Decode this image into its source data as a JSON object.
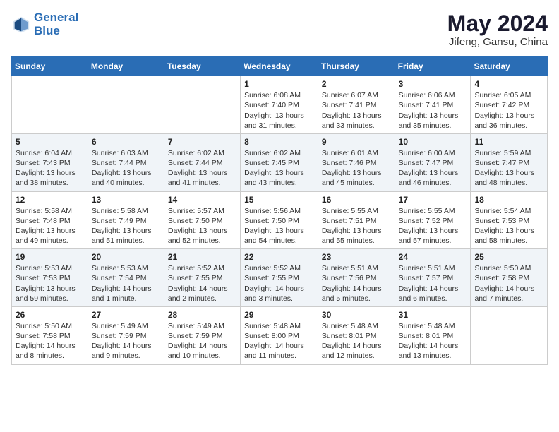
{
  "header": {
    "logo_line1": "General",
    "logo_line2": "Blue",
    "month_title": "May 2024",
    "subtitle": "Jifeng, Gansu, China"
  },
  "days_of_week": [
    "Sunday",
    "Monday",
    "Tuesday",
    "Wednesday",
    "Thursday",
    "Friday",
    "Saturday"
  ],
  "weeks": [
    [
      {
        "day": "",
        "info": ""
      },
      {
        "day": "",
        "info": ""
      },
      {
        "day": "",
        "info": ""
      },
      {
        "day": "1",
        "info": "Sunrise: 6:08 AM\nSunset: 7:40 PM\nDaylight: 13 hours\nand 31 minutes."
      },
      {
        "day": "2",
        "info": "Sunrise: 6:07 AM\nSunset: 7:41 PM\nDaylight: 13 hours\nand 33 minutes."
      },
      {
        "day": "3",
        "info": "Sunrise: 6:06 AM\nSunset: 7:41 PM\nDaylight: 13 hours\nand 35 minutes."
      },
      {
        "day": "4",
        "info": "Sunrise: 6:05 AM\nSunset: 7:42 PM\nDaylight: 13 hours\nand 36 minutes."
      }
    ],
    [
      {
        "day": "5",
        "info": "Sunrise: 6:04 AM\nSunset: 7:43 PM\nDaylight: 13 hours\nand 38 minutes."
      },
      {
        "day": "6",
        "info": "Sunrise: 6:03 AM\nSunset: 7:44 PM\nDaylight: 13 hours\nand 40 minutes."
      },
      {
        "day": "7",
        "info": "Sunrise: 6:02 AM\nSunset: 7:44 PM\nDaylight: 13 hours\nand 41 minutes."
      },
      {
        "day": "8",
        "info": "Sunrise: 6:02 AM\nSunset: 7:45 PM\nDaylight: 13 hours\nand 43 minutes."
      },
      {
        "day": "9",
        "info": "Sunrise: 6:01 AM\nSunset: 7:46 PM\nDaylight: 13 hours\nand 45 minutes."
      },
      {
        "day": "10",
        "info": "Sunrise: 6:00 AM\nSunset: 7:47 PM\nDaylight: 13 hours\nand 46 minutes."
      },
      {
        "day": "11",
        "info": "Sunrise: 5:59 AM\nSunset: 7:47 PM\nDaylight: 13 hours\nand 48 minutes."
      }
    ],
    [
      {
        "day": "12",
        "info": "Sunrise: 5:58 AM\nSunset: 7:48 PM\nDaylight: 13 hours\nand 49 minutes."
      },
      {
        "day": "13",
        "info": "Sunrise: 5:58 AM\nSunset: 7:49 PM\nDaylight: 13 hours\nand 51 minutes."
      },
      {
        "day": "14",
        "info": "Sunrise: 5:57 AM\nSunset: 7:50 PM\nDaylight: 13 hours\nand 52 minutes."
      },
      {
        "day": "15",
        "info": "Sunrise: 5:56 AM\nSunset: 7:50 PM\nDaylight: 13 hours\nand 54 minutes."
      },
      {
        "day": "16",
        "info": "Sunrise: 5:55 AM\nSunset: 7:51 PM\nDaylight: 13 hours\nand 55 minutes."
      },
      {
        "day": "17",
        "info": "Sunrise: 5:55 AM\nSunset: 7:52 PM\nDaylight: 13 hours\nand 57 minutes."
      },
      {
        "day": "18",
        "info": "Sunrise: 5:54 AM\nSunset: 7:53 PM\nDaylight: 13 hours\nand 58 minutes."
      }
    ],
    [
      {
        "day": "19",
        "info": "Sunrise: 5:53 AM\nSunset: 7:53 PM\nDaylight: 13 hours\nand 59 minutes."
      },
      {
        "day": "20",
        "info": "Sunrise: 5:53 AM\nSunset: 7:54 PM\nDaylight: 14 hours\nand 1 minute."
      },
      {
        "day": "21",
        "info": "Sunrise: 5:52 AM\nSunset: 7:55 PM\nDaylight: 14 hours\nand 2 minutes."
      },
      {
        "day": "22",
        "info": "Sunrise: 5:52 AM\nSunset: 7:55 PM\nDaylight: 14 hours\nand 3 minutes."
      },
      {
        "day": "23",
        "info": "Sunrise: 5:51 AM\nSunset: 7:56 PM\nDaylight: 14 hours\nand 5 minutes."
      },
      {
        "day": "24",
        "info": "Sunrise: 5:51 AM\nSunset: 7:57 PM\nDaylight: 14 hours\nand 6 minutes."
      },
      {
        "day": "25",
        "info": "Sunrise: 5:50 AM\nSunset: 7:58 PM\nDaylight: 14 hours\nand 7 minutes."
      }
    ],
    [
      {
        "day": "26",
        "info": "Sunrise: 5:50 AM\nSunset: 7:58 PM\nDaylight: 14 hours\nand 8 minutes."
      },
      {
        "day": "27",
        "info": "Sunrise: 5:49 AM\nSunset: 7:59 PM\nDaylight: 14 hours\nand 9 minutes."
      },
      {
        "day": "28",
        "info": "Sunrise: 5:49 AM\nSunset: 7:59 PM\nDaylight: 14 hours\nand 10 minutes."
      },
      {
        "day": "29",
        "info": "Sunrise: 5:48 AM\nSunset: 8:00 PM\nDaylight: 14 hours\nand 11 minutes."
      },
      {
        "day": "30",
        "info": "Sunrise: 5:48 AM\nSunset: 8:01 PM\nDaylight: 14 hours\nand 12 minutes."
      },
      {
        "day": "31",
        "info": "Sunrise: 5:48 AM\nSunset: 8:01 PM\nDaylight: 14 hours\nand 13 minutes."
      },
      {
        "day": "",
        "info": ""
      }
    ]
  ]
}
